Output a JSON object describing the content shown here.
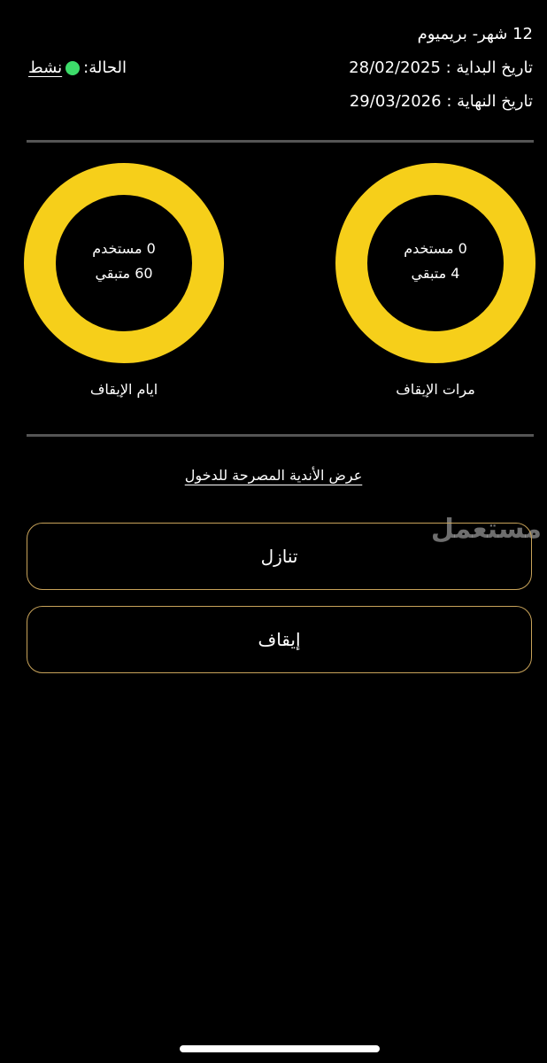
{
  "subscription": {
    "plan": "12 شهر- بريميوم",
    "start_date": "تاريخ البداية : 28/02/2025",
    "end_date": "تاريخ النهاية : 29/03/2026"
  },
  "status": {
    "label": "الحالة:",
    "value": "نشط",
    "color": "#3ddc6a"
  },
  "rings": {
    "color": "#f6cf1a",
    "freeze_count": {
      "used": "0 مستخدم",
      "remaining": "4 متبقي",
      "label": "مرات الإيقاف",
      "used_value": 0,
      "remaining_value": 4
    },
    "freeze_days": {
      "used": "0 مستخدم",
      "remaining": "60 متبقي",
      "label": "ايام الإيقاف",
      "used_value": 0,
      "remaining_value": 60
    }
  },
  "links": {
    "view_clubs": "عرض الأندية المصرحة للدخول"
  },
  "buttons": {
    "transfer": "تنازل",
    "freeze": "إيقاف"
  },
  "watermark": "مستعمل"
}
